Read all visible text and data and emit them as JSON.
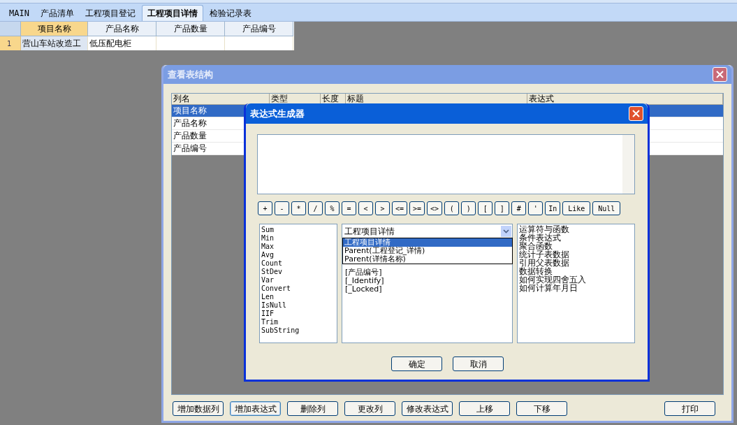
{
  "tabs": [
    {
      "label": "MAIN",
      "selected": false
    },
    {
      "label": "产品清单",
      "selected": false
    },
    {
      "label": "工程项目登记",
      "selected": false
    },
    {
      "label": "工程项目详情",
      "selected": true
    },
    {
      "label": "检验记录表",
      "selected": false
    }
  ],
  "grid": {
    "columns": [
      {
        "label": "项目名称",
        "selected": true
      },
      {
        "label": "产品名称",
        "selected": false
      },
      {
        "label": "产品数量",
        "selected": false
      },
      {
        "label": "产品编号",
        "selected": false
      }
    ],
    "rows": [
      {
        "number": "1",
        "cells": [
          "营山车站改造工",
          "低压配电柜",
          "",
          ""
        ]
      }
    ]
  },
  "structure_dialog": {
    "title": "查看表结构",
    "columns": [
      "列名",
      "类型",
      "长度",
      "标题",
      "表达式"
    ],
    "rows": [
      {
        "name": "项目名称",
        "selected": true
      },
      {
        "name": "产品名称",
        "selected": false
      },
      {
        "name": "产品数量",
        "selected": false
      },
      {
        "name": "产品编号",
        "selected": false
      }
    ],
    "buttons": [
      {
        "label": "增加数据列",
        "focused": false
      },
      {
        "label": "增加表达式",
        "focused": true
      },
      {
        "label": "删除列",
        "focused": false
      },
      {
        "label": "更改列",
        "focused": false
      },
      {
        "label": "修改表达式",
        "focused": false
      },
      {
        "label": "上移",
        "focused": false
      },
      {
        "label": "下移",
        "focused": false
      },
      {
        "label": "打印",
        "focused": false
      }
    ]
  },
  "expression_dialog": {
    "title": "表达式生成器",
    "operators": [
      "+",
      "-",
      "*",
      "/",
      "%",
      "=",
      "<",
      ">",
      "<=",
      ">=",
      "<>",
      "(",
      ")",
      "[",
      "]",
      "#",
      "'",
      "In",
      "Like",
      "Null"
    ],
    "functions": [
      "Sum",
      "Min",
      "Max",
      "Avg",
      "Count",
      "StDev",
      "Var",
      "Convert",
      "Len",
      "IsNull",
      "IIF",
      "Trim",
      "SubString"
    ],
    "table_select": {
      "value": "工程项目详情",
      "options": [
        {
          "label": "工程项目详情",
          "selected": true
        },
        {
          "label": "Parent(工程登记_详情)",
          "selected": false
        },
        {
          "label": "Parent(详情名称)",
          "selected": false
        }
      ]
    },
    "fields": [
      "[产品编号]",
      "[_Identify]",
      "[_Locked]"
    ],
    "help_topics": [
      "运算符与函数",
      "条件表达式",
      "聚合函数",
      "统计子表数据",
      "引用父表数据",
      "数据转换",
      "如何实现四舍五入",
      "如何计算年月日"
    ],
    "buttons": [
      "确定",
      "取消"
    ]
  }
}
